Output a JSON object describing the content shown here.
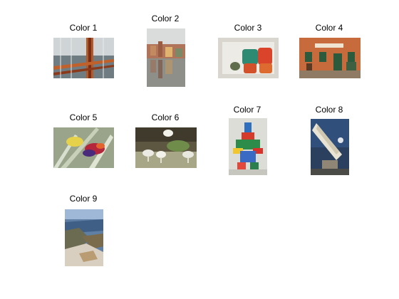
{
  "figure": {
    "images": [
      {
        "title": "Color 1",
        "subject": "bridge-cables"
      },
      {
        "title": "Color 2",
        "subject": "town-reflection"
      },
      {
        "title": "Color 3",
        "subject": "toy-cups"
      },
      {
        "title": "Color 4",
        "subject": "building-facade"
      },
      {
        "title": "Color 5",
        "subject": "flower-petals"
      },
      {
        "title": "Color 6",
        "subject": "goats-field"
      },
      {
        "title": "Color 7",
        "subject": "toy-robot"
      },
      {
        "title": "Color 8",
        "subject": "telescope"
      },
      {
        "title": "Color 9",
        "subject": "coastline"
      }
    ]
  }
}
